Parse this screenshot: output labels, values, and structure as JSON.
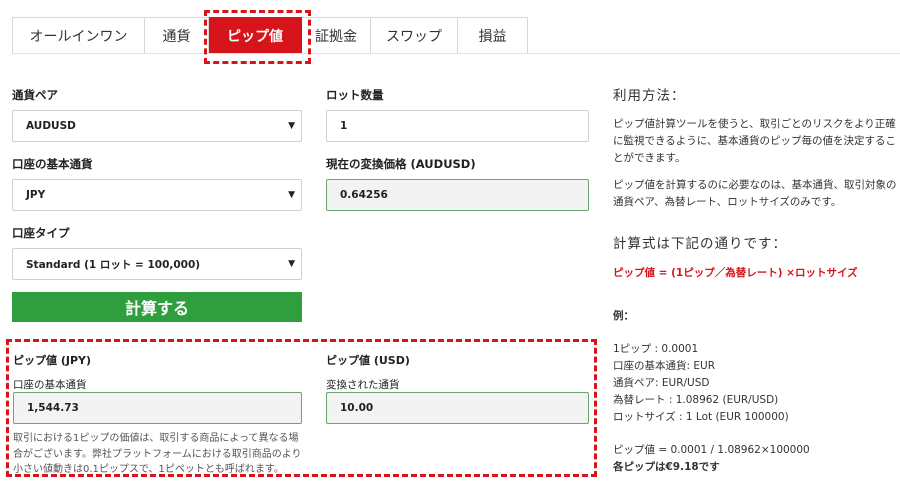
{
  "tabs": [
    {
      "label": "オールインワン"
    },
    {
      "label": "通貨"
    },
    {
      "label": "ピップ値"
    },
    {
      "label": "証拠金"
    },
    {
      "label": "スワップ"
    },
    {
      "label": "損益"
    }
  ],
  "active_tab": "ピップ値",
  "form": {
    "currency_pair_label": "通貨ペア",
    "currency_pair_value": "AUDUSD",
    "lot_label": "ロット数量",
    "lot_value": "1",
    "base_currency_label": "口座の基本通貨",
    "base_currency_value": "JPY",
    "conversion_label": "現在の変換価格 (AUDUSD)",
    "conversion_value": "0.64256",
    "account_type_label": "口座タイプ",
    "account_type_value": "Standard (1 ロット = 100,000)",
    "calculate_label": "計算する"
  },
  "result": {
    "pip_jpy_title": "ピップ値 (JPY)",
    "pip_jpy_sub": "口座の基本通貨",
    "pip_jpy_value": "1,544.73",
    "pip_usd_title": "ピップ値 (USD)",
    "pip_usd_sub": "変換された通貨",
    "pip_usd_value": "10.00",
    "note": "取引における1ピップの価値は、取引する商品によって異なる場合がございます。弊社プラットフォームにおける取引商品のより小さい値動きは0.1ピップスで、1ピペットとも呼ばれます。"
  },
  "info": {
    "usage_title": "利用方法：",
    "usage_p1": "ピップ値計算ツールを使うと、取引ごとのリスクをより正確に監視できるように、基本通貨のピップ毎の値を決定することができます。",
    "usage_p2": "ピップ値を計算するのに必要なのは、基本通貨、取引対象の通貨ペア、為替レート、ロットサイズのみです。",
    "formula_title": "計算式は下記の通りです：",
    "formula": "ピップ値 = (1ピップ／為替レート) ×ロットサイズ",
    "example_title": "例：",
    "example_lines": [
      "1ピップ : 0.0001",
      "口座の基本通貨: EUR",
      "通貨ペア: EUR/USD",
      "為替レート : 1.08962 (EUR/USD)",
      "ロットサイズ : 1 Lot (EUR 100000)"
    ],
    "example_calc": "ピップ値 = 0.0001 / 1.08962×100000",
    "example_result": "各ピップは€9.18です"
  },
  "colors": {
    "accent_red": "#d7141a",
    "button_green": "#2f9e3f"
  }
}
